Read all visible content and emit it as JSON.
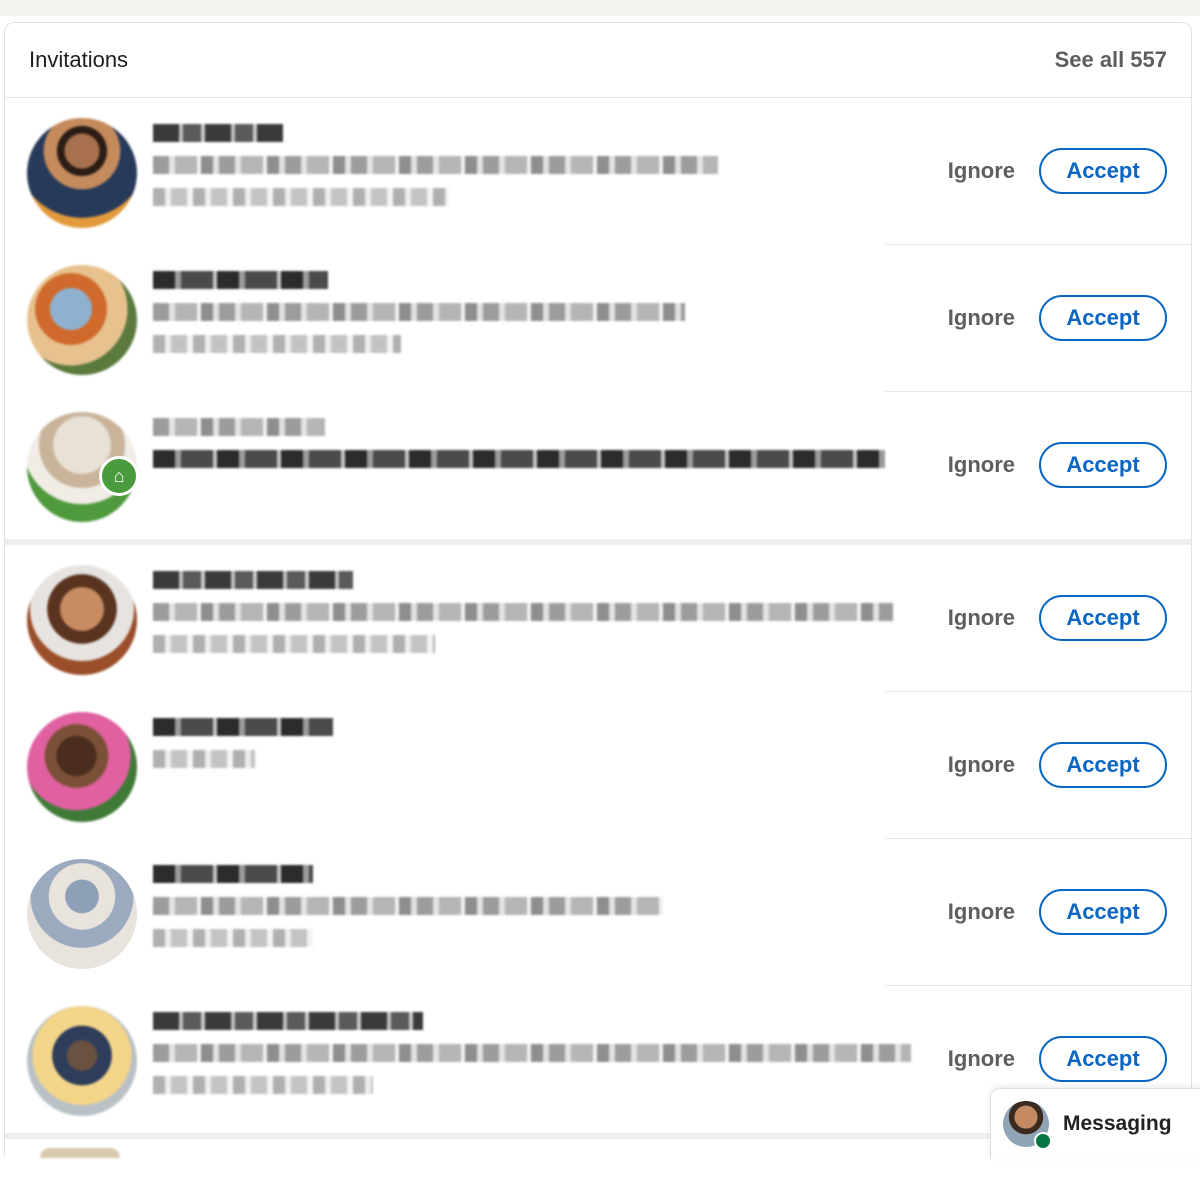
{
  "header": {
    "title": "Invitations",
    "see_all_label": "See all",
    "see_all_count": "557"
  },
  "actions": {
    "ignore_label": "Ignore",
    "accept_label": "Accept"
  },
  "messaging": {
    "label": "Messaging"
  },
  "colors": {
    "accent": "#0a66c2",
    "presence": "#057642"
  }
}
